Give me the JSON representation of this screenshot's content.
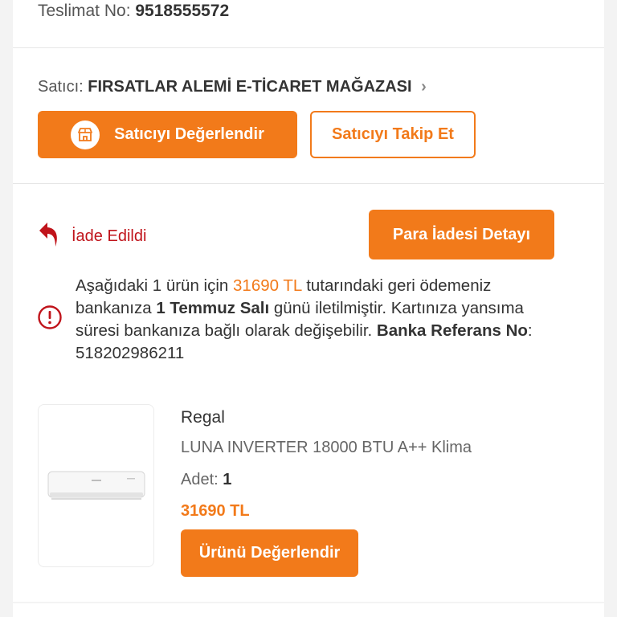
{
  "delivery": {
    "label": "Teslimat No:",
    "number": "9518555572"
  },
  "seller": {
    "label": "Satıcı:",
    "name": "FIRSATLAR ALEMİ E-TİCARET MAĞAZASI",
    "chevron": "›"
  },
  "buttons": {
    "rate_seller": "Satıcıyı Değerlendir",
    "follow_seller": "Satıcıyı Takip Et",
    "refund_detail": "Para İadesi Detayı",
    "rate_product": "Ürünü Değerlendir"
  },
  "status": {
    "label": "İade Edildi",
    "icon": "return-arrow-icon",
    "color": "#c0141b"
  },
  "refund_info": {
    "part1": "Aşağıdaki 1 ürün için ",
    "amount": "31690 TL",
    "part2": " tutarındaki geri ödemeniz bankanıza ",
    "date": "1 Temmuz Salı",
    "part3": " günü iletilmiştir. Kartınıza yansıma süresi bankanıza bağlı olarak değişebilir. ",
    "ref_label": "Banka Referans No",
    "ref_sep": ": ",
    "ref_number": "518202986211",
    "icon": "info-icon"
  },
  "product": {
    "brand": "Regal",
    "name": "LUNA INVERTER 18000 BTU A++ Klima",
    "qty_label": "Adet:",
    "qty_value": "1",
    "price": "31690 TL",
    "image": "air-conditioner-image"
  },
  "colors": {
    "accent": "#f27a1a",
    "danger": "#c0141b"
  }
}
